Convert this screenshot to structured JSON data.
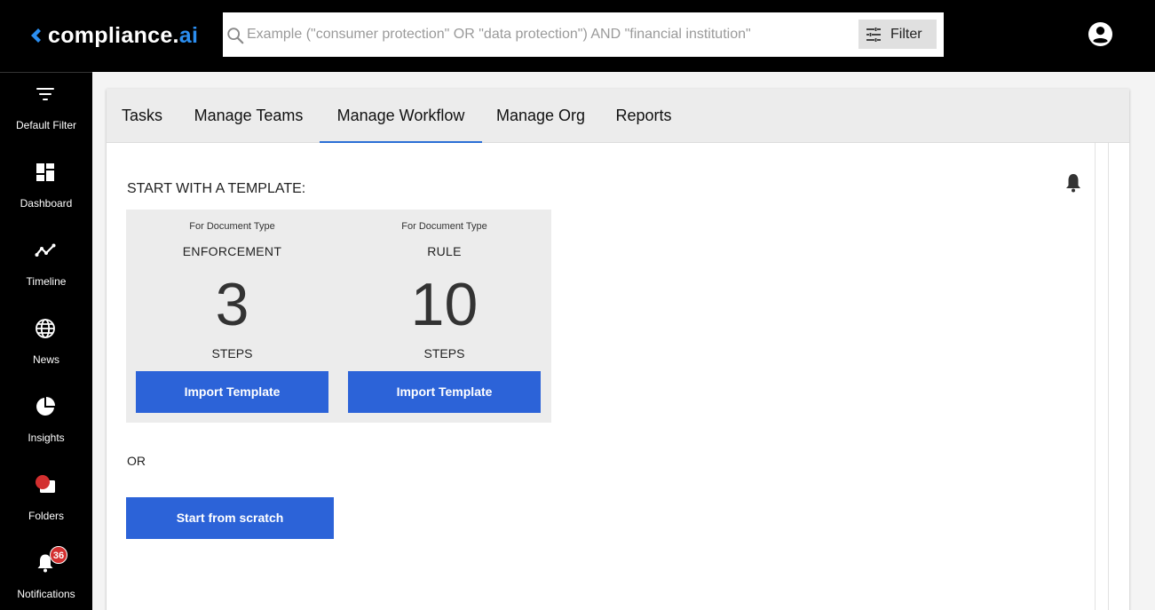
{
  "app": {
    "logo_main": "compliance.",
    "logo_accent": "ai"
  },
  "search": {
    "placeholder": "Example (\"consumer protection\" OR \"data protection\") AND \"financial institution\"",
    "filter_label": "Filter"
  },
  "sidebar": {
    "items": [
      {
        "label": "Default Filter",
        "icon": "filter-lines-icon"
      },
      {
        "label": "Dashboard",
        "icon": "dashboard-icon"
      },
      {
        "label": "Timeline",
        "icon": "timeline-icon"
      },
      {
        "label": "News",
        "icon": "globe-icon"
      },
      {
        "label": "Insights",
        "icon": "pie-chart-icon"
      },
      {
        "label": "Folders",
        "icon": "folder-icon"
      },
      {
        "label": "Notifications",
        "icon": "bell-icon",
        "badge": "36"
      }
    ]
  },
  "tabs": [
    {
      "label": "Tasks",
      "active": false
    },
    {
      "label": "Manage Teams",
      "active": false
    },
    {
      "label": "Manage Workflow",
      "active": true
    },
    {
      "label": "Manage Org",
      "active": false
    },
    {
      "label": "Reports",
      "active": false
    }
  ],
  "workflow": {
    "section_title": "START WITH A TEMPLATE:",
    "templates": [
      {
        "caption": "For Document Type",
        "doc_type": "ENFORCEMENT",
        "steps_count": "3",
        "steps_label": "STEPS",
        "button_label": "Import Template"
      },
      {
        "caption": "For Document Type",
        "doc_type": "RULE",
        "steps_count": "10",
        "steps_label": "STEPS",
        "button_label": "Import Template"
      }
    ],
    "or_text": "OR",
    "scratch_button_label": "Start from scratch"
  },
  "colors": {
    "primary_button": "#2c63d8",
    "active_tab_underline": "#2b6fd6",
    "badge": "#d32f2f",
    "logo_accent": "#2b8ef0"
  }
}
